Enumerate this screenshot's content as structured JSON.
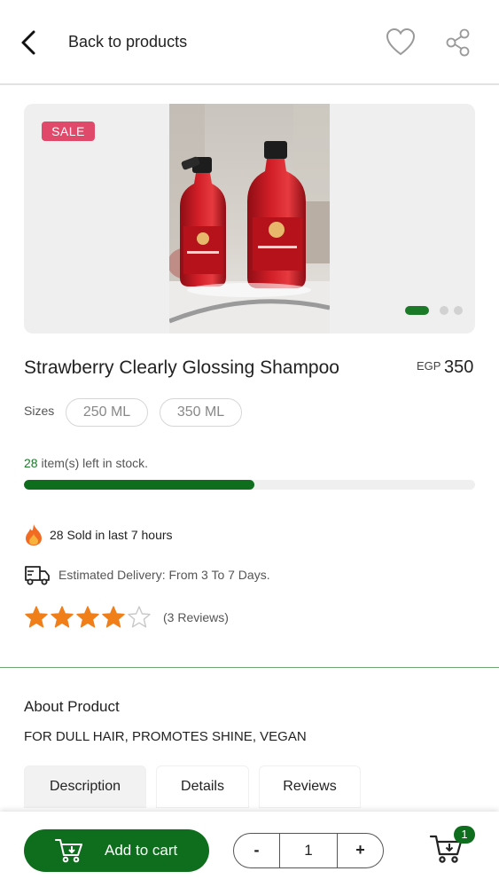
{
  "header": {
    "back_label": "Back to products",
    "back_icon": "chevron-left-icon",
    "favorite_icon": "heart-icon",
    "share_icon": "share-icon"
  },
  "gallery": {
    "sale_badge": "SALE",
    "image_count": 3,
    "active_index": 0
  },
  "product": {
    "title": "Strawberry Clearly Glossing Shampoo",
    "currency": "EGP",
    "price": "350",
    "sizes_label": "Sizes",
    "sizes": [
      "250 ML",
      "350 ML"
    ],
    "stock_count": "28",
    "stock_suffix": " item(s) left in stock.",
    "stock_fraction": 0.51,
    "sold_text": "28 Sold in last 7 hours",
    "delivery_text": "Estimated Delivery: From 3 To 7 Days.",
    "rating": 4,
    "rating_max": 5,
    "reviews_text": "(3 Reviews)"
  },
  "about": {
    "title": "About Product",
    "description": "FOR DULL HAIR, PROMOTES SHINE, VEGAN",
    "tabs": [
      "Description",
      "Details",
      "Reviews"
    ],
    "active_tab": 0
  },
  "bottom_bar": {
    "add_to_cart_label": "Add to cart",
    "decrement_label": "-",
    "increment_label": "+",
    "quantity": "1",
    "cart_badge_count": "1"
  },
  "colors": {
    "brand_green": "#0f6e1d",
    "sale_pink": "#e0496a",
    "star_orange": "#f07f1a",
    "divider_green": "#6aa870"
  }
}
